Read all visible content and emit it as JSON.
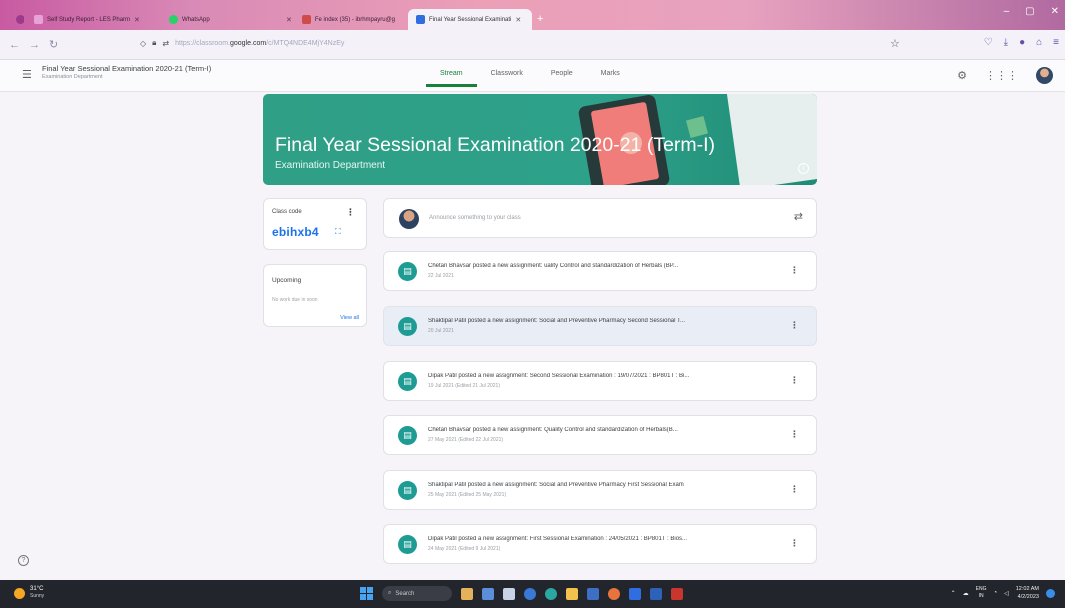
{
  "browser": {
    "tabs": [
      {
        "label": "Self Study Report - LES Pharm",
        "favicon_color": "#e8a3d6"
      },
      {
        "label": "WhatsApp",
        "favicon_color": "#25d366"
      },
      {
        "label": "Fe index (35) - ibrhmpayru@g",
        "favicon_color": "#d14a4a"
      },
      {
        "label": "Final Year Sessional Examinati",
        "favicon_color": "#2f6de0"
      }
    ],
    "active_tab": 3,
    "url_prefix": "https://classroom.",
    "url_host": "google.com",
    "url_path": "/c/MTQ4NDE4MjY4NzEy"
  },
  "classroom": {
    "header_title": "Final Year Sessional Examination 2020-21 (Term-I)",
    "header_subtitle": "Examination Department",
    "nav_tabs": [
      "Stream",
      "Classwork",
      "People",
      "Marks"
    ],
    "active_nav": "Stream",
    "banner_title": "Final Year Sessional Examination 2020-21 (Term-I)",
    "banner_subtitle": "Examination Department",
    "class_code_label": "Class code",
    "class_code": "ebihxb4",
    "upcoming_title": "Upcoming",
    "upcoming_text": "No work due in soon",
    "view_all": "View all",
    "announce_placeholder": "Announce something to your class",
    "posts": [
      {
        "title": "Chetan Bhavsar posted a new assignment: uality Control and standardization of Herbals (BP...",
        "date": "22 Jul 2021",
        "highlight": false
      },
      {
        "title": "Shaktipal Patil posted a new assignment: Social and Preventive Pharmacy Second Sessional T...",
        "date": "20 Jul 2021",
        "highlight": true
      },
      {
        "title": "Dipak Patil posted a new assignment: Second Sessional Examination : 19/07/2021 : BP801T : Bi...",
        "date": "19 Jul 2021 (Edited 21 Jul 2021)",
        "highlight": false
      },
      {
        "title": "Chetan Bhavsar posted a new assignment: Quality Control and standardization of Herbals(B...",
        "date": "27 May 2021 (Edited 22 Jul 2021)",
        "highlight": false
      },
      {
        "title": "Shaktipal Patil posted a new assignment: Social and Preventive Pharmacy First Sessional Exam",
        "date": "25 May 2021 (Edited 25 May 2021)",
        "highlight": false
      },
      {
        "title": "Dipak Patil posted a new assignment: First Sessional Examination : 24/05/2021 : BP801T : Bios...",
        "date": "24 May 2021 (Edited 9 Jul 2021)",
        "highlight": false
      }
    ]
  },
  "taskbar": {
    "weather_temp": "31°C",
    "weather_desc": "Sunny",
    "search_label": "Search",
    "lang_top": "ENG",
    "lang_bottom": "IN",
    "time": "12:02 AM",
    "date": "4/2/2023"
  }
}
